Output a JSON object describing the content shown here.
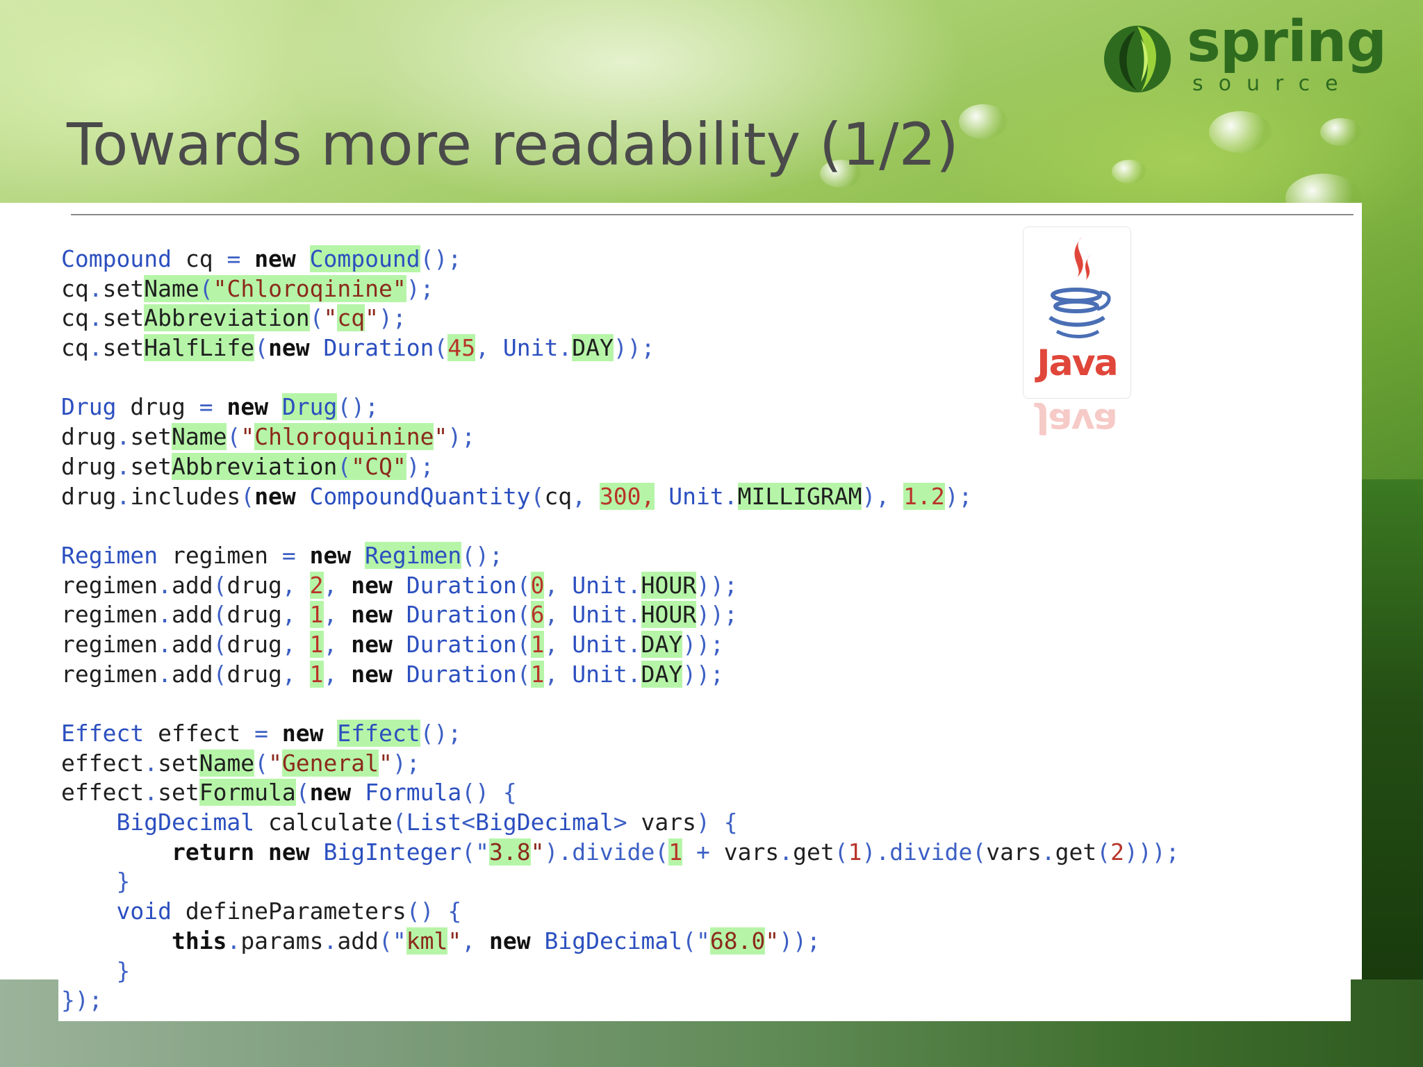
{
  "slide": {
    "title": "Towards more readability (1/2)"
  },
  "logos": {
    "spring_word": "spring",
    "spring_sub": "source",
    "java_word": "Java"
  },
  "colors": {
    "title": "#4a4a4a",
    "logo_green": "#2e6b1f",
    "code_type": "#2b4fbf",
    "code_keyword": "#111111",
    "code_string": "#8b2a1c",
    "code_number": "#b8342a",
    "highlight": "#b6f5a8",
    "java_red": "#e0463a"
  },
  "code": {
    "lines": [
      [
        [
          "Compound",
          "type"
        ],
        [
          " cq ",
          "id"
        ],
        [
          "=",
          "punc"
        ],
        [
          " ",
          "id"
        ],
        [
          "new",
          "kw"
        ],
        [
          " ",
          "id"
        ],
        [
          "Compound",
          "type",
          1
        ],
        [
          "();",
          "punc"
        ]
      ],
      [
        [
          "cq",
          "id"
        ],
        [
          ".",
          "punc"
        ],
        [
          "set",
          "id"
        ],
        [
          "Name",
          "id",
          1
        ],
        [
          "(",
          "punc",
          1
        ],
        [
          "\"Chloroqinine\"",
          "str",
          1
        ],
        [
          ");",
          "punc"
        ]
      ],
      [
        [
          "cq",
          "id"
        ],
        [
          ".",
          "punc"
        ],
        [
          "set",
          "id"
        ],
        [
          "Abbreviation",
          "id",
          1
        ],
        [
          "(",
          "punc"
        ],
        [
          "\"",
          "str"
        ],
        [
          "cq",
          "str",
          1
        ],
        [
          "\"",
          "str"
        ],
        [
          ");",
          "punc"
        ]
      ],
      [
        [
          "cq",
          "id"
        ],
        [
          ".",
          "punc"
        ],
        [
          "set",
          "id"
        ],
        [
          "HalfLife",
          "id",
          1
        ],
        [
          "(",
          "punc"
        ],
        [
          "new",
          "kw"
        ],
        [
          " ",
          "id"
        ],
        [
          "Duration",
          "type"
        ],
        [
          "(",
          "punc"
        ],
        [
          "45",
          "num",
          1
        ],
        [
          ", ",
          "punc"
        ],
        [
          "Unit",
          "type"
        ],
        [
          ".",
          "punc"
        ],
        [
          "DAY",
          "id",
          1
        ],
        [
          "));",
          "punc"
        ]
      ],
      [],
      [
        [
          "Drug",
          "type"
        ],
        [
          " drug ",
          "id"
        ],
        [
          "=",
          "punc"
        ],
        [
          " ",
          "id"
        ],
        [
          "new",
          "kw"
        ],
        [
          " ",
          "id"
        ],
        [
          "Drug",
          "type",
          1
        ],
        [
          "();",
          "punc"
        ]
      ],
      [
        [
          "drug",
          "id"
        ],
        [
          ".",
          "punc"
        ],
        [
          "set",
          "id"
        ],
        [
          "Name",
          "id",
          1
        ],
        [
          "(",
          "punc"
        ],
        [
          "\"",
          "str"
        ],
        [
          "Chloroquinine",
          "str",
          1
        ],
        [
          "\"",
          "str"
        ],
        [
          ");",
          "punc"
        ]
      ],
      [
        [
          "drug",
          "id"
        ],
        [
          ".",
          "punc"
        ],
        [
          "set",
          "id"
        ],
        [
          "Abbreviation",
          "id",
          1
        ],
        [
          "(",
          "punc",
          1
        ],
        [
          "\"CQ\"",
          "str",
          1
        ],
        [
          ");",
          "punc"
        ]
      ],
      [
        [
          "drug",
          "id"
        ],
        [
          ".",
          "punc"
        ],
        [
          "includes",
          "id"
        ],
        [
          "(",
          "punc"
        ],
        [
          "new",
          "kw"
        ],
        [
          " ",
          "id"
        ],
        [
          "CompoundQuantity",
          "type"
        ],
        [
          "(",
          "punc"
        ],
        [
          "cq",
          "id"
        ],
        [
          ", ",
          "punc"
        ],
        [
          "300,",
          "num",
          1
        ],
        [
          " ",
          "id"
        ],
        [
          "Unit",
          "type"
        ],
        [
          ".",
          "punc"
        ],
        [
          "MILLIGRAM",
          "id",
          1
        ],
        [
          "), ",
          "punc"
        ],
        [
          "1.2",
          "num",
          1
        ],
        [
          ");",
          "punc"
        ]
      ],
      [],
      [
        [
          "Regimen",
          "type"
        ],
        [
          " regimen ",
          "id"
        ],
        [
          "=",
          "punc"
        ],
        [
          " ",
          "id"
        ],
        [
          "new",
          "kw"
        ],
        [
          " ",
          "id"
        ],
        [
          "Regimen",
          "type",
          1
        ],
        [
          "();",
          "punc"
        ]
      ],
      [
        [
          "regimen",
          "id"
        ],
        [
          ".",
          "punc"
        ],
        [
          "add",
          "id"
        ],
        [
          "(",
          "punc"
        ],
        [
          "drug",
          "id"
        ],
        [
          ", ",
          "punc"
        ],
        [
          "2",
          "num",
          1
        ],
        [
          ", ",
          "punc"
        ],
        [
          "new",
          "kw"
        ],
        [
          " ",
          "id"
        ],
        [
          "Duration",
          "type"
        ],
        [
          "(",
          "punc"
        ],
        [
          "0",
          "num",
          1
        ],
        [
          ", ",
          "punc"
        ],
        [
          "Unit",
          "type"
        ],
        [
          ".",
          "punc"
        ],
        [
          "HOUR",
          "id",
          1
        ],
        [
          "));",
          "punc"
        ]
      ],
      [
        [
          "regimen",
          "id"
        ],
        [
          ".",
          "punc"
        ],
        [
          "add",
          "id"
        ],
        [
          "(",
          "punc"
        ],
        [
          "drug",
          "id"
        ],
        [
          ", ",
          "punc"
        ],
        [
          "1",
          "num",
          1
        ],
        [
          ", ",
          "punc"
        ],
        [
          "new",
          "kw"
        ],
        [
          " ",
          "id"
        ],
        [
          "Duration",
          "type"
        ],
        [
          "(",
          "punc"
        ],
        [
          "6",
          "num",
          1
        ],
        [
          ", ",
          "punc"
        ],
        [
          "Unit",
          "type"
        ],
        [
          ".",
          "punc"
        ],
        [
          "HOUR",
          "id",
          1
        ],
        [
          "));",
          "punc"
        ]
      ],
      [
        [
          "regimen",
          "id"
        ],
        [
          ".",
          "punc"
        ],
        [
          "add",
          "id"
        ],
        [
          "(",
          "punc"
        ],
        [
          "drug",
          "id"
        ],
        [
          ", ",
          "punc"
        ],
        [
          "1",
          "num",
          1
        ],
        [
          ", ",
          "punc"
        ],
        [
          "new",
          "kw"
        ],
        [
          " ",
          "id"
        ],
        [
          "Duration",
          "type"
        ],
        [
          "(",
          "punc"
        ],
        [
          "1",
          "num",
          1
        ],
        [
          ", ",
          "punc"
        ],
        [
          "Unit",
          "type"
        ],
        [
          ".",
          "punc"
        ],
        [
          "DAY",
          "id",
          1
        ],
        [
          "));",
          "punc"
        ]
      ],
      [
        [
          "regimen",
          "id"
        ],
        [
          ".",
          "punc"
        ],
        [
          "add",
          "id"
        ],
        [
          "(",
          "punc"
        ],
        [
          "drug",
          "id"
        ],
        [
          ", ",
          "punc"
        ],
        [
          "1",
          "num",
          1
        ],
        [
          ", ",
          "punc"
        ],
        [
          "new",
          "kw"
        ],
        [
          " ",
          "id"
        ],
        [
          "Duration",
          "type"
        ],
        [
          "(",
          "punc"
        ],
        [
          "1",
          "num",
          1
        ],
        [
          ", ",
          "punc"
        ],
        [
          "Unit",
          "type"
        ],
        [
          ".",
          "punc"
        ],
        [
          "DAY",
          "id",
          1
        ],
        [
          "));",
          "punc"
        ]
      ],
      [],
      [
        [
          "Effect",
          "type"
        ],
        [
          " effect ",
          "id"
        ],
        [
          "=",
          "punc"
        ],
        [
          " ",
          "id"
        ],
        [
          "new",
          "kw"
        ],
        [
          " ",
          "id"
        ],
        [
          "Effect",
          "type",
          1
        ],
        [
          "();",
          "punc"
        ]
      ],
      [
        [
          "effect",
          "id"
        ],
        [
          ".",
          "punc"
        ],
        [
          "set",
          "id"
        ],
        [
          "Name",
          "id",
          1
        ],
        [
          "(",
          "punc"
        ],
        [
          "\"",
          "str"
        ],
        [
          "General",
          "str",
          1
        ],
        [
          "\"",
          "str"
        ],
        [
          ");",
          "punc"
        ]
      ],
      [
        [
          "effect",
          "id"
        ],
        [
          ".",
          "punc"
        ],
        [
          "set",
          "id"
        ],
        [
          "Formula",
          "id",
          1
        ],
        [
          "(",
          "punc"
        ],
        [
          "new",
          "kw"
        ],
        [
          " ",
          "id"
        ],
        [
          "Formula",
          "type"
        ],
        [
          "() {",
          "punc"
        ]
      ],
      [
        [
          "    ",
          "id"
        ],
        [
          "BigDecimal",
          "type"
        ],
        [
          " calculate",
          "id"
        ],
        [
          "(",
          "punc"
        ],
        [
          "List",
          "type"
        ],
        [
          "<",
          "punc"
        ],
        [
          "BigDecimal",
          "type"
        ],
        [
          ">",
          "punc"
        ],
        [
          " vars",
          "id"
        ],
        [
          ") {",
          "punc"
        ]
      ],
      [
        [
          "        ",
          "id"
        ],
        [
          "return",
          "kw"
        ],
        [
          " ",
          "id"
        ],
        [
          "new",
          "kw"
        ],
        [
          " ",
          "id"
        ],
        [
          "BigInteger",
          "type"
        ],
        [
          "(\"",
          "punc"
        ],
        [
          "3.8",
          "str",
          1
        ],
        [
          "\"",
          "str"
        ],
        [
          ").divide(",
          "punc"
        ],
        [
          "1",
          "num",
          1
        ],
        [
          " + ",
          "punc"
        ],
        [
          "vars",
          "id"
        ],
        [
          ".",
          "punc"
        ],
        [
          "get",
          "id"
        ],
        [
          "(",
          "punc"
        ],
        [
          "1",
          "num"
        ],
        [
          ").divide(",
          "punc"
        ],
        [
          "vars",
          "id"
        ],
        [
          ".",
          "punc"
        ],
        [
          "get",
          "id"
        ],
        [
          "(",
          "punc"
        ],
        [
          "2",
          "num"
        ],
        [
          ")));",
          "punc"
        ]
      ],
      [
        [
          "    ",
          "id"
        ],
        [
          "}",
          "punc"
        ]
      ],
      [
        [
          "    ",
          "id"
        ],
        [
          "void",
          "type"
        ],
        [
          " defineParameters",
          "id"
        ],
        [
          "() {",
          "punc"
        ]
      ],
      [
        [
          "        ",
          "id"
        ],
        [
          "this",
          "kw"
        ],
        [
          ".",
          "punc"
        ],
        [
          "params",
          "id"
        ],
        [
          ".",
          "punc"
        ],
        [
          "add",
          "id"
        ],
        [
          "(\"",
          "punc"
        ],
        [
          "kml",
          "str",
          1
        ],
        [
          "\"",
          "str"
        ],
        [
          ", ",
          "punc"
        ],
        [
          "new",
          "kw"
        ],
        [
          " ",
          "id"
        ],
        [
          "BigDecimal",
          "type"
        ],
        [
          "(\"",
          "punc"
        ],
        [
          "68.0",
          "str",
          1
        ],
        [
          "\"",
          "str"
        ],
        [
          "));",
          "punc"
        ]
      ],
      [
        [
          "    ",
          "id"
        ],
        [
          "}",
          "punc"
        ]
      ],
      [
        [
          "});",
          "punc"
        ]
      ]
    ]
  }
}
